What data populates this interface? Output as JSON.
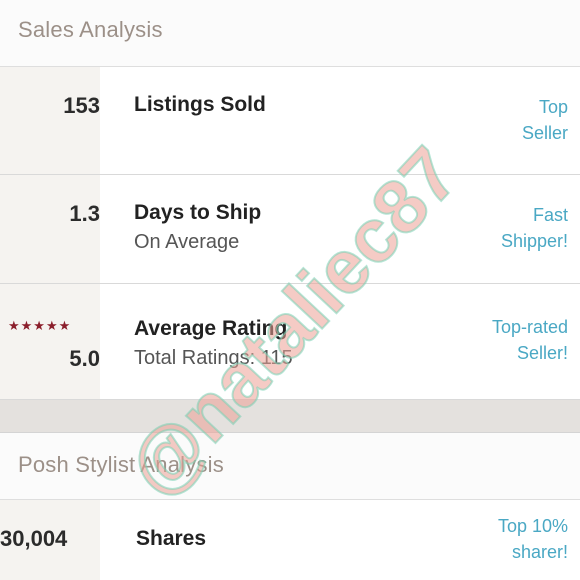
{
  "sales_section": {
    "title": "Sales Analysis",
    "rows": [
      {
        "stat": "153",
        "label": "Listings Sold",
        "sublabel": "",
        "badge_line1": "Top",
        "badge_line2": "Seller"
      },
      {
        "stat": "1.3",
        "label": "Days to Ship",
        "sublabel": "On Average",
        "badge_line1": "Fast",
        "badge_line2": "Shipper!"
      },
      {
        "stars": "★★★★★",
        "stat": "5.0",
        "label": "Average Rating",
        "sublabel": "Total Ratings: 115",
        "badge_line1": "Top-rated",
        "badge_line2": "Seller!"
      }
    ]
  },
  "stylist_section": {
    "title": "Posh Stylist Analysis",
    "rows": [
      {
        "stat": "30,004",
        "label": "Shares",
        "badge_line1": "Top 10%",
        "badge_line2": "sharer!"
      }
    ]
  },
  "watermark": {
    "text": "@nataliec87"
  },
  "colors": {
    "accent": "#4aa8c4",
    "star": "#8b1e2b",
    "stat_column": "#f5f3f0",
    "section_title": "#9c9088"
  }
}
